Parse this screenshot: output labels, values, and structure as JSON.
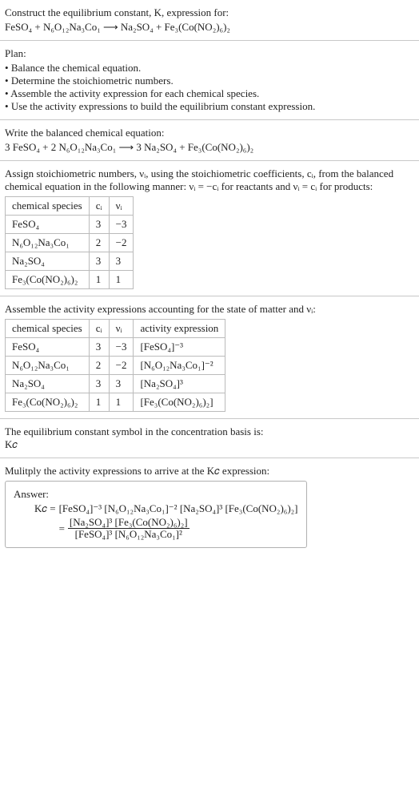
{
  "header": {
    "prompt": "Construct the equilibrium constant, K, expression for:",
    "equation": "FeSO₄ + N₆O₁₂Na₃Co₁ ⟶ Na₂SO₄ + Fe₃(Co(NO₂)₆)₂"
  },
  "plan": {
    "title": "Plan:",
    "items": [
      "Balance the chemical equation.",
      "Determine the stoichiometric numbers.",
      "Assemble the activity expression for each chemical species.",
      "Use the activity expressions to build the equilibrium constant expression."
    ]
  },
  "balanced": {
    "intro": "Write the balanced chemical equation:",
    "equation": "3 FeSO₄ + 2 N₆O₁₂Na₃Co₁ ⟶ 3 Na₂SO₄ + Fe₃(Co(NO₂)₆)₂"
  },
  "assign": {
    "intro_a": "Assign stoichiometric numbers, νᵢ, using the stoichiometric coefficients, cᵢ, from the balanced chemical equation in the following manner: νᵢ = −cᵢ for reactants and νᵢ = cᵢ for products:",
    "table": {
      "headers": [
        "chemical species",
        "cᵢ",
        "νᵢ"
      ],
      "rows": [
        [
          "FeSO₄",
          "3",
          "−3"
        ],
        [
          "N₆O₁₂Na₃Co₁",
          "2",
          "−2"
        ],
        [
          "Na₂SO₄",
          "3",
          "3"
        ],
        [
          "Fe₃(Co(NO₂)₆)₂",
          "1",
          "1"
        ]
      ]
    }
  },
  "activity": {
    "intro": "Assemble the activity expressions accounting for the state of matter and νᵢ:",
    "table": {
      "headers": [
        "chemical species",
        "cᵢ",
        "νᵢ",
        "activity expression"
      ],
      "rows": [
        [
          "FeSO₄",
          "3",
          "−3",
          "[FeSO₄]⁻³"
        ],
        [
          "N₆O₁₂Na₃Co₁",
          "2",
          "−2",
          "[N₆O₁₂Na₃Co₁]⁻²"
        ],
        [
          "Na₂SO₄",
          "3",
          "3",
          "[Na₂SO₄]³"
        ],
        [
          "Fe₃(Co(NO₂)₆)₂",
          "1",
          "1",
          "[Fe₃(Co(NO₂)₆)₂]"
        ]
      ]
    }
  },
  "symbol": {
    "intro": "The equilibrium constant symbol in the concentration basis is:",
    "value": "K𝑐"
  },
  "multiply": {
    "intro": "Mulitply the activity expressions to arrive at the K𝑐 expression:"
  },
  "answer": {
    "label": "Answer:",
    "lhs": "K𝑐 =",
    "line1": "[FeSO₄]⁻³ [N₆O₁₂Na₃Co₁]⁻² [Na₂SO₄]³ [Fe₃(Co(NO₂)₆)₂]",
    "eq2": "=",
    "frac_num": "[Na₂SO₄]³ [Fe₃(Co(NO₂)₆)₂]",
    "frac_den": "[FeSO₄]³ [N₆O₁₂Na₃Co₁]²"
  }
}
